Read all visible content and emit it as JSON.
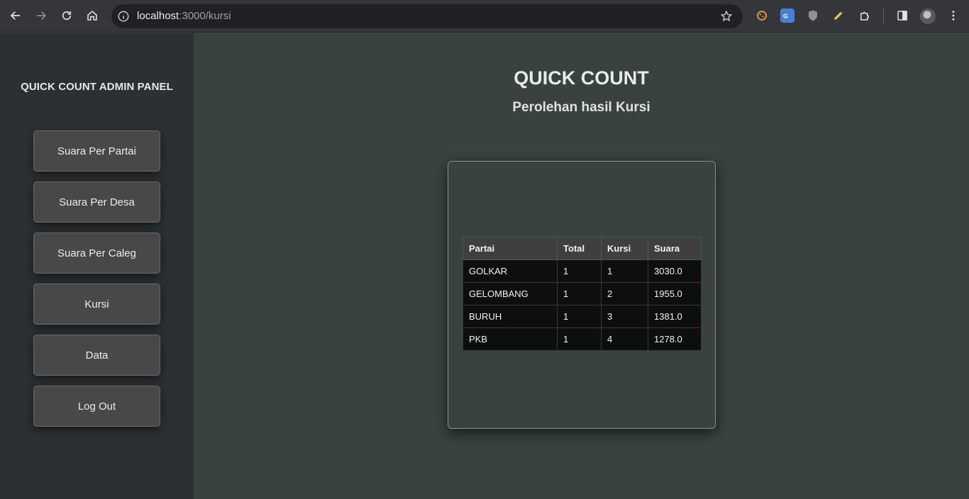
{
  "browser": {
    "url_host": "localhost",
    "url_path": ":3000/kursi"
  },
  "sidebar": {
    "title": "QUICK COUNT ADMIN PANEL",
    "items": [
      {
        "label": "Suara Per Partai"
      },
      {
        "label": "Suara Per Desa"
      },
      {
        "label": "Suara Per Caleg"
      },
      {
        "label": "Kursi"
      },
      {
        "label": "Data"
      },
      {
        "label": "Log Out"
      }
    ]
  },
  "main": {
    "title": "QUICK COUNT",
    "subtitle": "Perolehan hasil Kursi",
    "table": {
      "headers": [
        "Partai",
        "Total",
        "Kursi",
        "Suara"
      ],
      "rows": [
        [
          "GOLKAR",
          "1",
          "1",
          "3030.0"
        ],
        [
          "GELOMBANG",
          "1",
          "2",
          "1955.0"
        ],
        [
          "BURUH",
          "1",
          "3",
          "1381.0"
        ],
        [
          "PKB",
          "1",
          "4",
          "1278.0"
        ]
      ]
    }
  },
  "icons": [
    "back-icon",
    "forward-icon",
    "reload-icon",
    "home-icon",
    "info-icon",
    "star-icon",
    "cookie-extension-icon",
    "translate-extension-icon",
    "ublock-extension-icon",
    "pen-extension-icon",
    "extensions-puzzle-icon",
    "side-panel-icon",
    "profile-avatar",
    "menu-kebab-icon"
  ],
  "colors": {
    "page_bg": "#3a4141",
    "sidebar_bg": "#2b3133",
    "button_bg": "#484848",
    "table_header_bg": "#3f3f3f",
    "table_cell_bg": "#0d0e0e"
  }
}
